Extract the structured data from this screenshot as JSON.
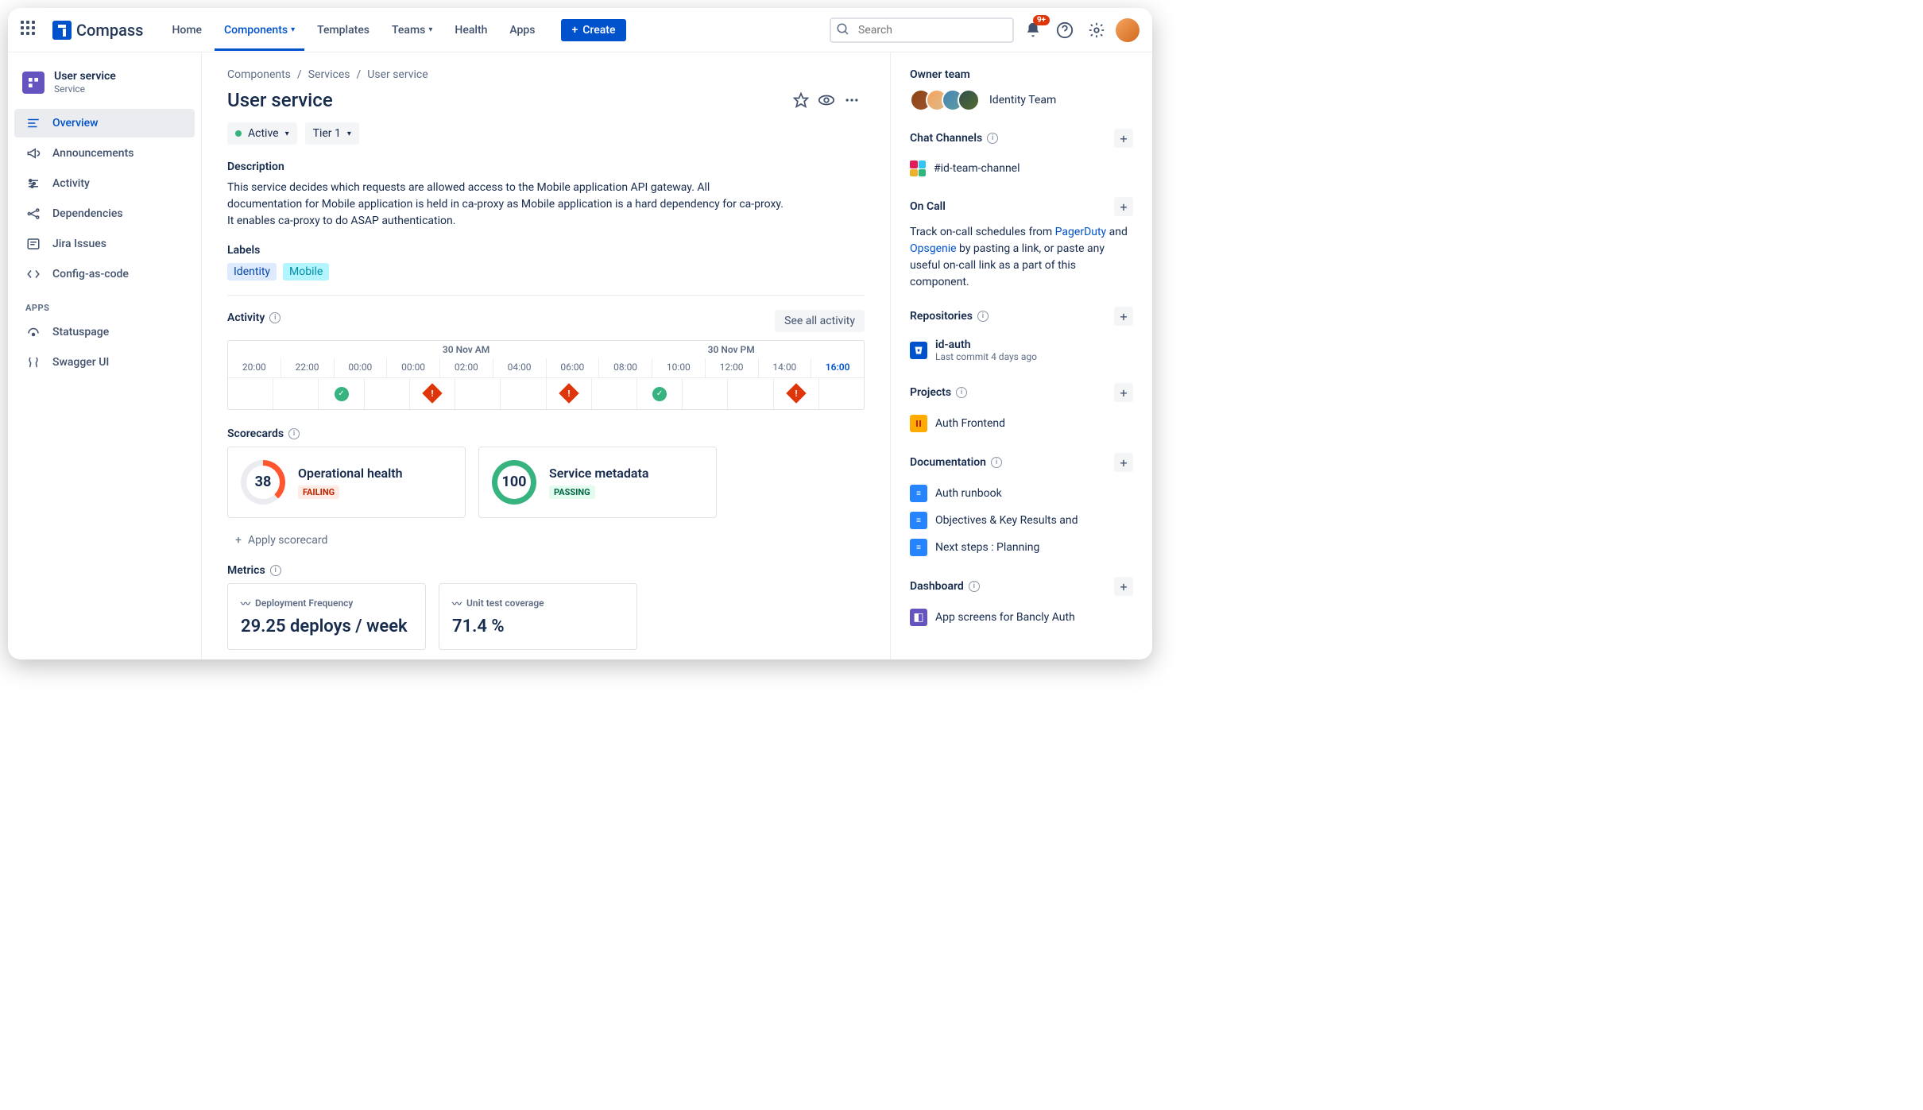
{
  "header": {
    "product": "Compass",
    "nav": [
      "Home",
      "Components",
      "Templates",
      "Teams",
      "Health",
      "Apps"
    ],
    "active_nav": "Components",
    "create": "Create",
    "search_placeholder": "Search",
    "notification_badge": "9+"
  },
  "sidebar": {
    "title": "User service",
    "subtitle": "Service",
    "items": [
      "Overview",
      "Announcements",
      "Activity",
      "Dependencies",
      "Jira Issues",
      "Config-as-code"
    ],
    "active": "Overview",
    "apps_label": "APPS",
    "apps": [
      "Statuspage",
      "Swagger UI"
    ]
  },
  "breadcrumb": [
    "Components",
    "Services",
    "User service"
  ],
  "page_title": "User service",
  "status_chip": "Active",
  "tier_chip": "Tier 1",
  "description_h": "Description",
  "description": "This service decides which requests are allowed access to the Mobile application API gateway. All documentation for Mobile application is held in ca-proxy as Mobile application is a hard dependency for ca-proxy. It enables ca-proxy to do ASAP authentication.",
  "labels_h": "Labels",
  "labels": {
    "identity": "Identity",
    "mobile": "Mobile"
  },
  "activity_h": "Activity",
  "see_all": "See all activity",
  "timeline": {
    "periods": [
      "30 Nov AM",
      "30 Nov PM"
    ],
    "hours": [
      "20:00",
      "22:00",
      "00:00",
      "00:00",
      "02:00",
      "04:00",
      "06:00",
      "08:00",
      "10:00",
      "12:00",
      "14:00",
      "16:00"
    ],
    "events": [
      "",
      "",
      "ok",
      "",
      "err",
      "",
      "",
      "err",
      "",
      "ok",
      "",
      "",
      "err",
      ""
    ]
  },
  "scorecards_h": "Scorecards",
  "scorecards": [
    {
      "score": "38",
      "title": "Operational health",
      "status": "FAILING",
      "kind": "fail"
    },
    {
      "score": "100",
      "title": "Service metadata",
      "status": "PASSING",
      "kind": "pass"
    }
  ],
  "apply_scorecard": "Apply scorecard",
  "metrics_h": "Metrics",
  "metrics": [
    {
      "label": "Deployment Frequency",
      "value": "29.25 deploys / week"
    },
    {
      "label": "Unit test coverage",
      "value": "71.4 %"
    }
  ],
  "right": {
    "owner_h": "Owner team",
    "team_name": "Identity Team",
    "chat_h": "Chat Channels",
    "chat_channel": "#id-team-channel",
    "oncall_h": "On Call",
    "oncall_text_1": "Track on-call schedules from ",
    "oncall_link_1": "PagerDuty",
    "oncall_text_2": " and ",
    "oncall_link_2": "Opsgenie",
    "oncall_text_3": " by pasting a link, or paste any useful on-call link as a part of this component.",
    "repos_h": "Repositories",
    "repo_name": "id-auth",
    "repo_sub": "Last commit 4 days ago",
    "projects_h": "Projects",
    "project_name": "Auth Frontend",
    "docs_h": "Documentation",
    "docs": [
      "Auth runbook",
      "Objectives & Key Results and",
      "Next steps : Planning"
    ],
    "dashboard_h": "Dashboard",
    "dashboard_item": "App screens for Bancly Auth"
  }
}
